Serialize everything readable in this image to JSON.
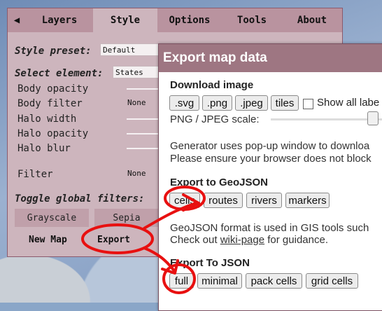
{
  "tabs": [
    {
      "label": "◀"
    },
    {
      "label": "Layers"
    },
    {
      "label": "Style"
    },
    {
      "label": "Options"
    },
    {
      "label": "Tools"
    },
    {
      "label": "About"
    }
  ],
  "style": {
    "preset_label": "Style preset:",
    "preset_value": "Default",
    "element_label": "Select element:",
    "element_value": "States",
    "body_opacity": "Body opacity",
    "body_filter": "Body filter",
    "body_filter_value": "None",
    "halo_width": "Halo width",
    "halo_opacity": "Halo opacity",
    "halo_blur": "Halo blur",
    "filter": "Filter",
    "filter_value": "None",
    "toggle_label": "Toggle global filters:",
    "grayscale": "Grayscale",
    "sepia": "Sepia",
    "new_map": "New Map",
    "export": "Export"
  },
  "dialog": {
    "title": "Export map data",
    "download_heading": "Download image",
    "btn_svg": ".svg",
    "btn_png": ".png",
    "btn_jpeg": ".jpeg",
    "btn_tiles": "tiles",
    "show_all_labels": "Show all labe",
    "scale_label": "PNG / JPEG scale:",
    "generator_line1": "Generator uses pop-up window to downloa",
    "generator_line2": "Please ensure your browser does not block",
    "geojson_heading": "Export to GeoJSON",
    "btn_cells": "cells",
    "btn_routes": "routes",
    "btn_rivers": "rivers",
    "btn_markers": "markers",
    "geojson_line1": "GeoJSON format is used in GIS tools such",
    "geojson_line2_pre": "Check out ",
    "geojson_link": "wiki-page",
    "geojson_line2_post": " for guidance.",
    "json_heading": "Export To JSON",
    "btn_full": "full",
    "btn_minimal": "minimal",
    "btn_pack": "pack cells",
    "btn_grid": "grid cells"
  },
  "colors": {
    "annotation": "#e81010",
    "dialog_title_bg": "#9e7682",
    "panel_bg": "#cdb5bd"
  }
}
